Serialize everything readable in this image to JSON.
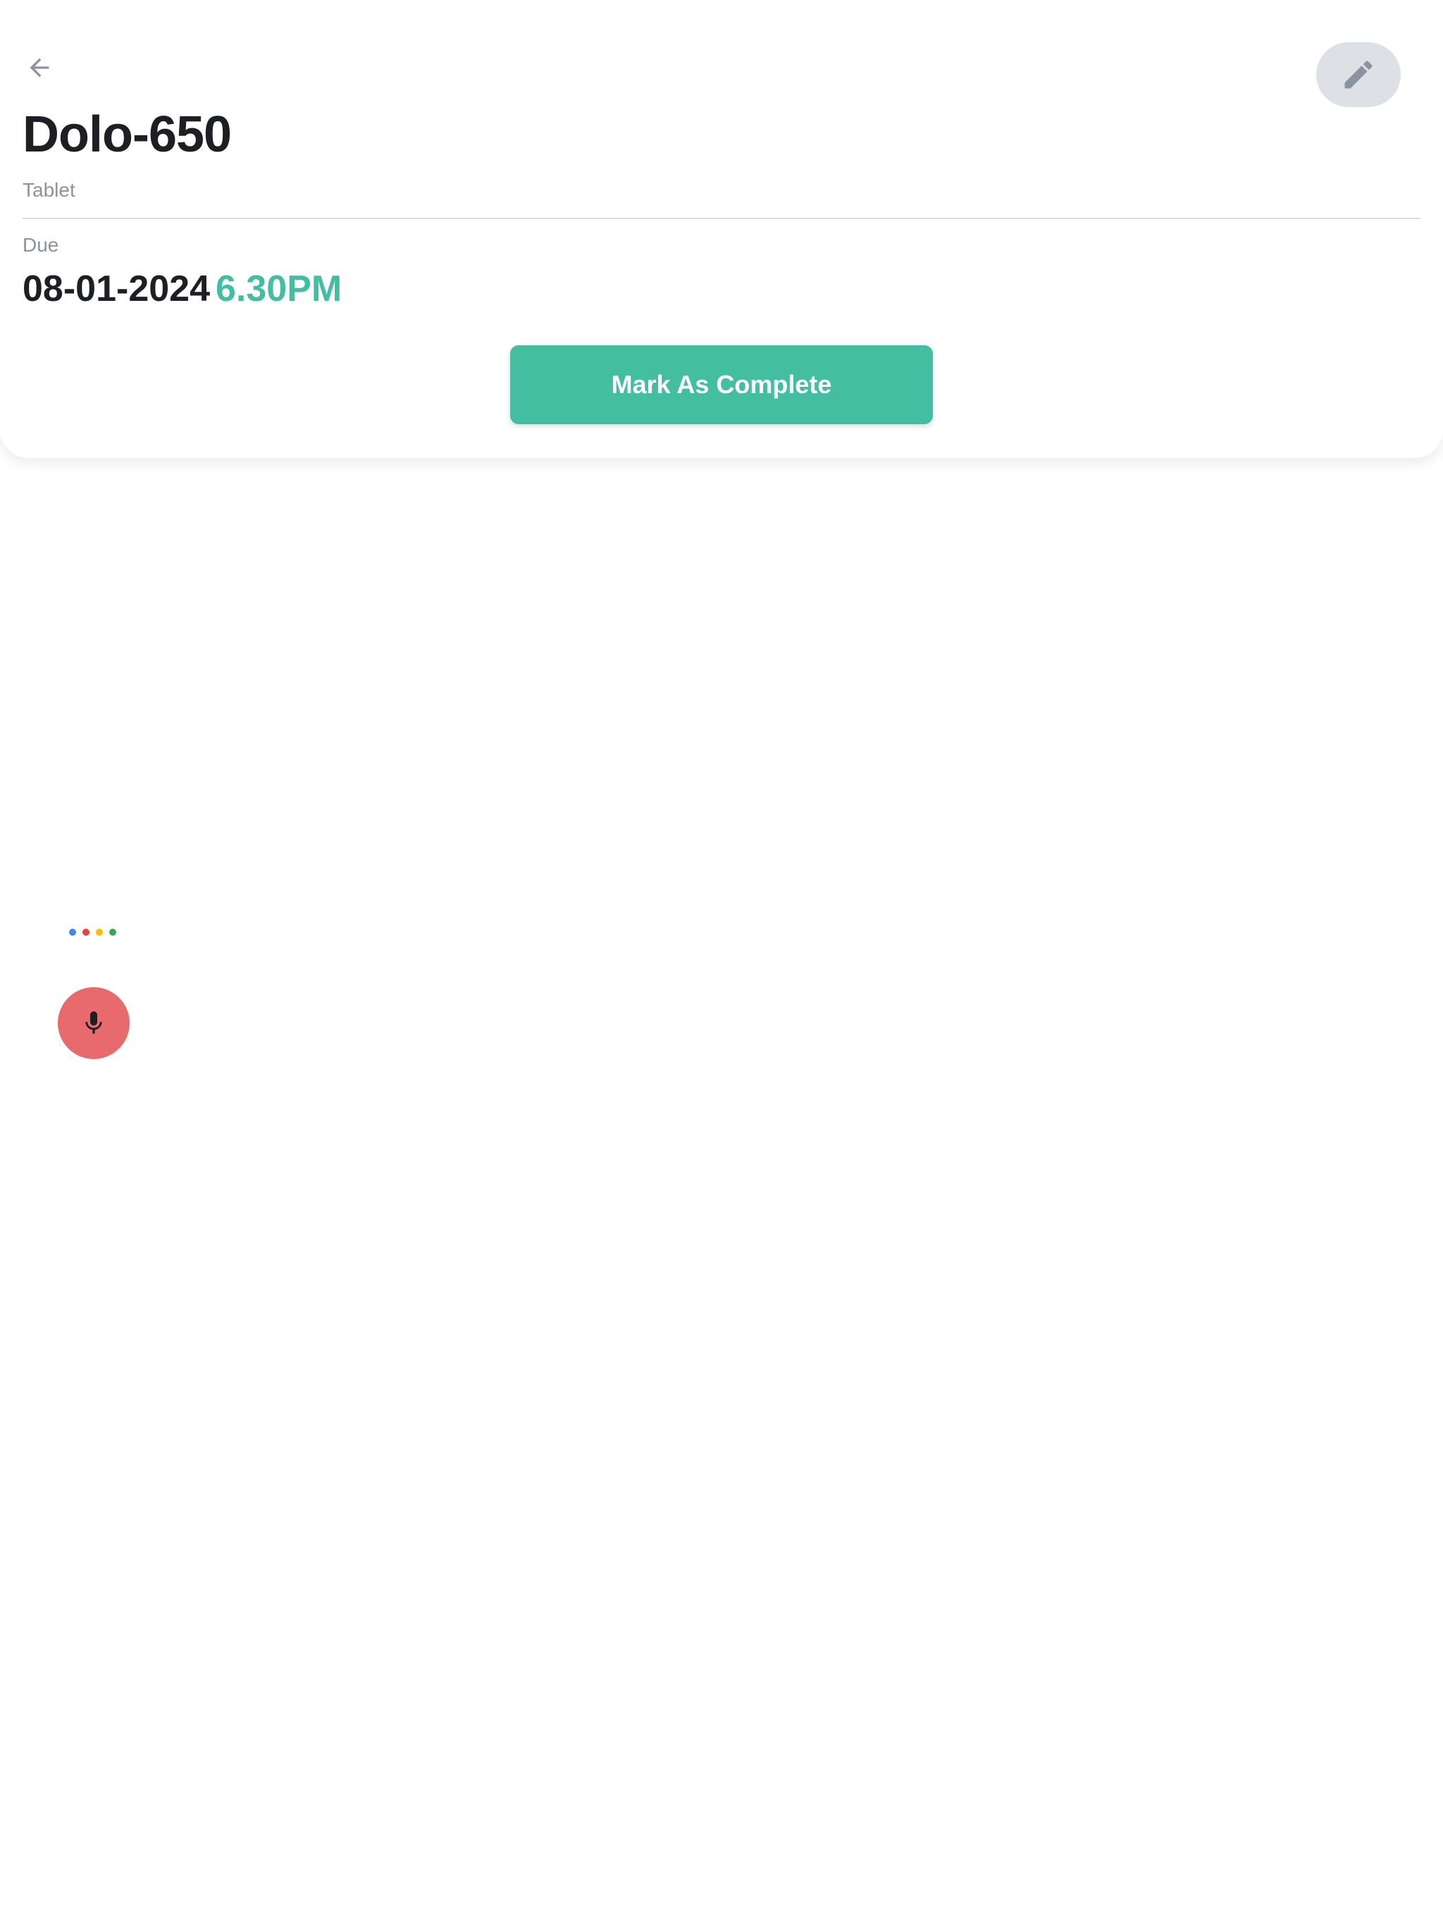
{
  "header": {
    "back_icon": "arrow-left-icon",
    "edit_icon": "pencil-icon"
  },
  "medicine": {
    "name": "Dolo-650",
    "type": "Tablet"
  },
  "due": {
    "label": "Due",
    "date": "08-01-2024",
    "time": "6.30PM"
  },
  "actions": {
    "complete_label": "Mark As Complete"
  },
  "assistant": {
    "dot_colors": [
      "#4285F4",
      "#EA4335",
      "#FBBC05",
      "#34A853"
    ],
    "mic_icon": "microphone-icon"
  },
  "colors": {
    "accent": "#43bea1",
    "mic": "#e86a6c",
    "edit_bg": "#dde1e6"
  }
}
